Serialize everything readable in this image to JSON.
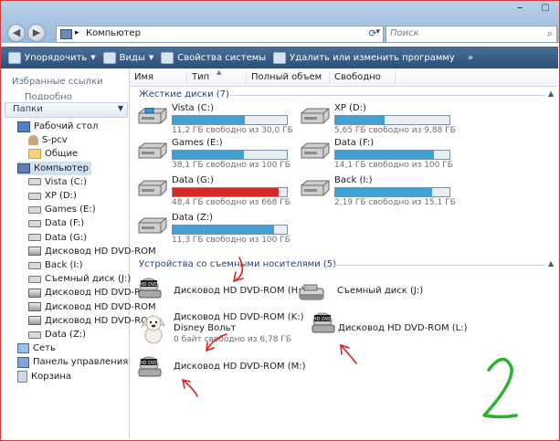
{
  "window": {
    "buttons": [
      "⎯",
      "▢"
    ]
  },
  "address": {
    "path": "Компьютер",
    "separator": "▸"
  },
  "search": {
    "placeholder": "Поиск"
  },
  "toolbar": {
    "organize": "Упорядочить",
    "views": "Виды",
    "system_props": "Свойства системы",
    "uninstall": "Удалить или изменить программу"
  },
  "left": {
    "favorites": "Избранные ссылки",
    "favorites_sub": "Подробно",
    "folders": "Папки",
    "tree": [
      {
        "label": "Рабочий стол",
        "icon": "desktop-icon"
      },
      {
        "label": "S-pcv",
        "icon": "user-folder-icon"
      },
      {
        "label": "Общие",
        "icon": "folder-icon"
      },
      {
        "label": "Компьютер",
        "icon": "computer-icon"
      },
      {
        "label": "Vista (C:)",
        "icon": "drive-icon"
      },
      {
        "label": "XP (D:)",
        "icon": "drive-icon"
      },
      {
        "label": "Games (E:)",
        "icon": "drive-icon"
      },
      {
        "label": "Data (F:)",
        "icon": "drive-icon"
      },
      {
        "label": "Data (G:)",
        "icon": "drive-icon"
      },
      {
        "label": "Дисковод HD DVD-ROM",
        "icon": "dvd-drive-icon"
      },
      {
        "label": "Back (I:)",
        "icon": "drive-icon"
      },
      {
        "label": "Съемный диск (J:)",
        "icon": "removable-disk-icon"
      },
      {
        "label": "Дисковод HD DVD-ROM",
        "icon": "dvd-drive-icon"
      },
      {
        "label": "Дисковод HD DVD-ROM",
        "icon": "dvd-drive-icon"
      },
      {
        "label": "Дисковод HD DVD-ROM",
        "icon": "dvd-drive-icon"
      },
      {
        "label": "Data (Z:)",
        "icon": "drive-icon"
      },
      {
        "label": "Сеть",
        "icon": "network-icon"
      },
      {
        "label": "Панель управления",
        "icon": "control-panel-icon"
      },
      {
        "label": "Корзина",
        "icon": "recycle-bin-icon"
      }
    ]
  },
  "columns": [
    "Имя",
    "Тип",
    "Полный объем",
    "Свободно"
  ],
  "hard_disks": {
    "title": "Жесткие диски (7)",
    "items": [
      {
        "name": "Vista (C:)",
        "free": "11,2 ГБ свободно из 30,0 ГБ",
        "used_fraction": 0.63,
        "color": "#3ea1d6"
      },
      {
        "name": "XP (D:)",
        "free": "5,65 ГБ свободно из 9,88 ГБ",
        "used_fraction": 0.43,
        "color": "#3ea1d6"
      },
      {
        "name": "Games (E:)",
        "free": "38,1 ГБ свободно из 100 ГБ",
        "used_fraction": 0.62,
        "color": "#3ea1d6"
      },
      {
        "name": "Data (F:)",
        "free": "14,1 ГБ свободно из 100 ГБ",
        "used_fraction": 0.86,
        "color": "#3ea1d6"
      },
      {
        "name": "Data (G:)",
        "free": "48,4 ГБ свободно из 668 ГБ",
        "used_fraction": 0.93,
        "color": "#d9262b"
      },
      {
        "name": "Back (I:)",
        "free": "2,19 ГБ свободно из 15,1 ГБ",
        "used_fraction": 0.85,
        "color": "#3ea1d6"
      },
      {
        "name": "Data (Z:)",
        "free": "11,3 ГБ свободно из 100 ГБ",
        "used_fraction": 0.89,
        "color": "#3ea1d6"
      }
    ]
  },
  "removable": {
    "title": "Устройства со съемными носителями (5)",
    "items": [
      {
        "name": "Дисковод HD DVD-ROM (H:)"
      },
      {
        "name": "Съемный диск (J:)"
      },
      {
        "name": "Дисковод HD DVD-ROM (K:)",
        "label": "Disney Вольт",
        "free": "0 байт свободно из 6,78 ГБ"
      },
      {
        "name": "Дисковод HD DVD-ROM (L:)"
      },
      {
        "name": "Дисковод HD DVD-ROM (M:)"
      }
    ],
    "dvd_badge": "HD DVD"
  },
  "annotation": {
    "digit": "2"
  }
}
